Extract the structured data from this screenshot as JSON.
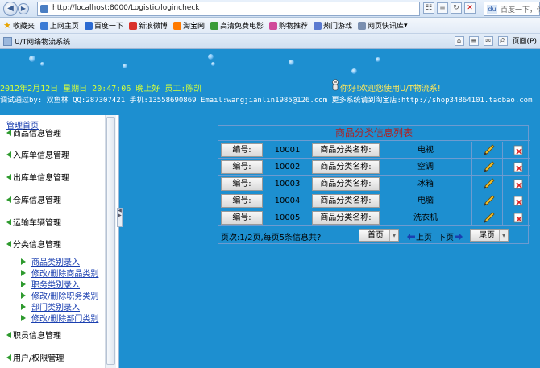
{
  "browser": {
    "url": "http://localhost:8000/Logistic/logincheck",
    "search_placeholder": "百度一下，你",
    "favorites": [
      {
        "label": "收藏夹",
        "color": "#e8a400"
      },
      {
        "label": "上网主页",
        "color": "#3a7bd5"
      },
      {
        "label": "百度一下",
        "color": "#2b6ad1"
      },
      {
        "label": "新浪微博",
        "color": "#d9312b"
      },
      {
        "label": "淘宝网",
        "color": "#ff7a00"
      },
      {
        "label": "高清免费电影",
        "color": "#3a9c3a"
      },
      {
        "label": "购物推荐",
        "color": "#d04a9a"
      },
      {
        "label": "热门游戏",
        "color": "#5a7ad0"
      },
      {
        "label": "网页快讯库",
        "color": "#7a8fb0"
      }
    ],
    "tab_title": "U/T网络物流系统",
    "page_menu": "页面(P)"
  },
  "banner": {
    "datetime": "2012年2月12日 星期日 20:47:06 晚上好      员工:陈凯",
    "welcome": "你好!欢迎您使用U/T物流系!",
    "credits": "调试通过by: 双鱼林 QQ:287307421 手机:13558690869 Email:wangjianlin1985@126.com 更多系统请到淘宝店:http://shop34864101.taobao.com"
  },
  "sidebar": {
    "home": "管理首页",
    "menus": [
      {
        "label": "商品信息管理"
      },
      {
        "label": "入库单信息管理"
      },
      {
        "label": "出库单信息管理"
      },
      {
        "label": "仓库信息管理"
      },
      {
        "label": "运输车辆管理"
      },
      {
        "label": "分类信息管理"
      }
    ],
    "sub_items": [
      "商品类别录入",
      "修改/删除商品类别",
      "职务类别录入",
      "修改/删除职务类别",
      "部门类别录入",
      "修改/删除部门类别"
    ],
    "menus_after": [
      {
        "label": "职员信息管理"
      },
      {
        "label": "用户/权限管理"
      }
    ]
  },
  "table": {
    "title": "商品分类信息列表",
    "id_label": "编号:",
    "name_label": "商品分类名称:",
    "rows": [
      {
        "id": "10001",
        "name": "电视"
      },
      {
        "id": "10002",
        "name": "空调"
      },
      {
        "id": "10003",
        "name": "冰箱"
      },
      {
        "id": "10004",
        "name": "电脑"
      },
      {
        "id": "10005",
        "name": "洗衣机"
      }
    ],
    "pager_info": "页次:1/2页,每页5条信息共?",
    "first": "首页",
    "prev": "上页",
    "next": "下页",
    "last": "尾页"
  }
}
